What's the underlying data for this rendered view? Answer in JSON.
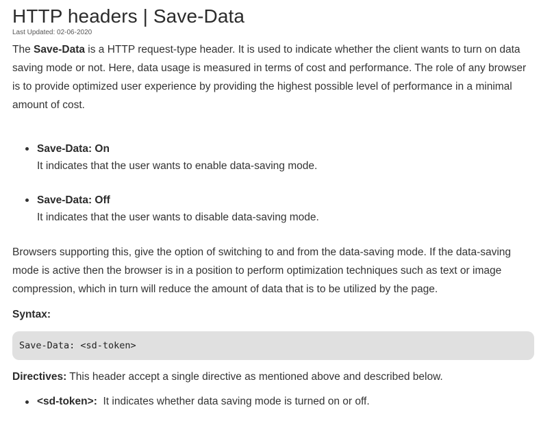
{
  "article": {
    "title": "HTTP headers | Save-Data",
    "last_updated": "Last Updated: 02-06-2020",
    "intro": {
      "lead": "The ",
      "bold": "Save-Data",
      "rest": " is a HTTP request-type header. It is used to indicate whether the client wants to turn on data saving mode or not. Here, data usage is measured in terms of cost and performance. The role of any browser is to provide optimized user experience by providing the highest possible level of performance in a minimal amount of cost."
    },
    "values": [
      {
        "name": "Save-Data: On",
        "description": "It indicates that the user wants to enable data-saving mode."
      },
      {
        "name": "Save-Data: Off",
        "description": "It indicates that the user wants to disable data-saving mode."
      }
    ],
    "browsers_paragraph": "Browsers supporting this, give the option of switching to and from the data-saving mode. If the data-saving mode is active then the browser is in a position to perform optimization techniques such as text or image compression, which in turn will reduce the amount of data that is to be utilized by the page.",
    "syntax": {
      "heading": "Syntax:",
      "code": "Save-Data: <sd-token>"
    },
    "directives": {
      "label": "Directives:",
      "text": " This header accept a single directive as mentioned above and described below.",
      "items": [
        {
          "name": "<sd-token>:",
          "description": "  It indicates whether data saving mode is turned on or off."
        }
      ]
    }
  }
}
